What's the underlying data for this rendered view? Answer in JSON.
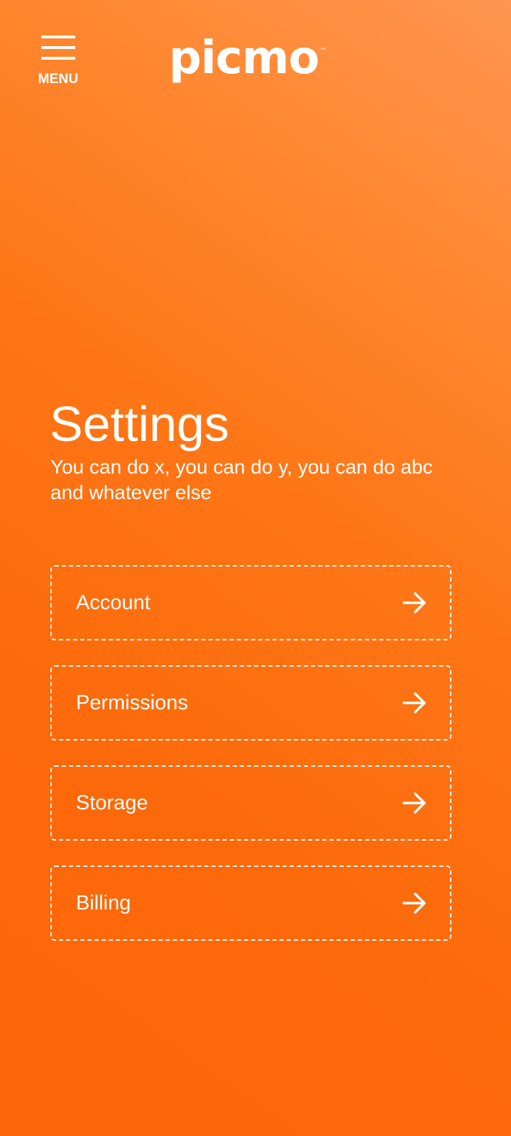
{
  "header": {
    "menu_label": "MENU",
    "menu_icon": "hamburger-menu-icon",
    "logo_text": "picmo",
    "logo_tm": "™"
  },
  "main": {
    "title": "Settings",
    "subtitle": "You can do x, you can do y, you can do abc and whatever else"
  },
  "settings": {
    "items": [
      {
        "label": "Account",
        "icon": "arrow-right-icon"
      },
      {
        "label": "Permissions",
        "icon": "arrow-right-icon"
      },
      {
        "label": "Storage",
        "icon": "arrow-right-icon"
      },
      {
        "label": "Billing",
        "icon": "arrow-right-icon"
      }
    ]
  },
  "colors": {
    "background_top_right": "#ff9550",
    "background_primary": "#fc690a",
    "foreground": "#ffffff"
  }
}
